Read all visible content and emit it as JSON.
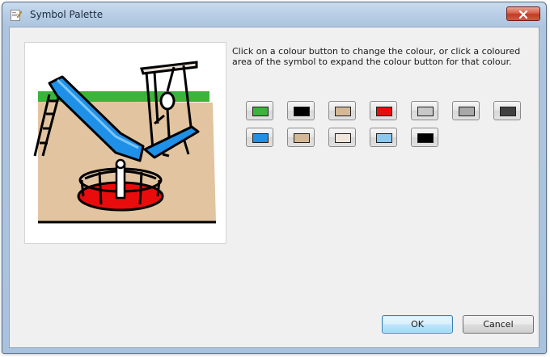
{
  "window": {
    "title": "Symbol Palette",
    "title_icon": "symbol-palette-icon",
    "close_icon": "close-icon"
  },
  "instructions": "Click on a colour button to change the colour, or click a coloured area of the symbol to expand the colour button for that colour.",
  "symbol": {
    "description_icon": "playground-symbol",
    "colors": {
      "grass": "#3ab43a",
      "sand": "#e2c4a0",
      "slide": "#1e90e8",
      "roundabout": "#e80c0c",
      "outline": "#000000",
      "ladder": "#ffffff",
      "rail": "#e8e0d8"
    }
  },
  "color_buttons": [
    {
      "name": "green",
      "color": "#3ab43a"
    },
    {
      "name": "black",
      "color": "#000000"
    },
    {
      "name": "tan",
      "color": "#d4b896"
    },
    {
      "name": "red",
      "color": "#e80c0c"
    },
    {
      "name": "light-grey",
      "color": "#c8c8c8"
    },
    {
      "name": "mid-grey",
      "color": "#a8a8a8"
    },
    {
      "name": "dark-grey",
      "color": "#404040"
    },
    {
      "name": "blue",
      "color": "#1e90e8"
    },
    {
      "name": "sand",
      "color": "#d4b896"
    },
    {
      "name": "off-white",
      "color": "#f0e6dc"
    },
    {
      "name": "light-blue",
      "color": "#8cc8f0"
    },
    {
      "name": "black-2",
      "color": "#000000"
    }
  ],
  "buttons": {
    "ok": "OK",
    "cancel": "Cancel"
  }
}
